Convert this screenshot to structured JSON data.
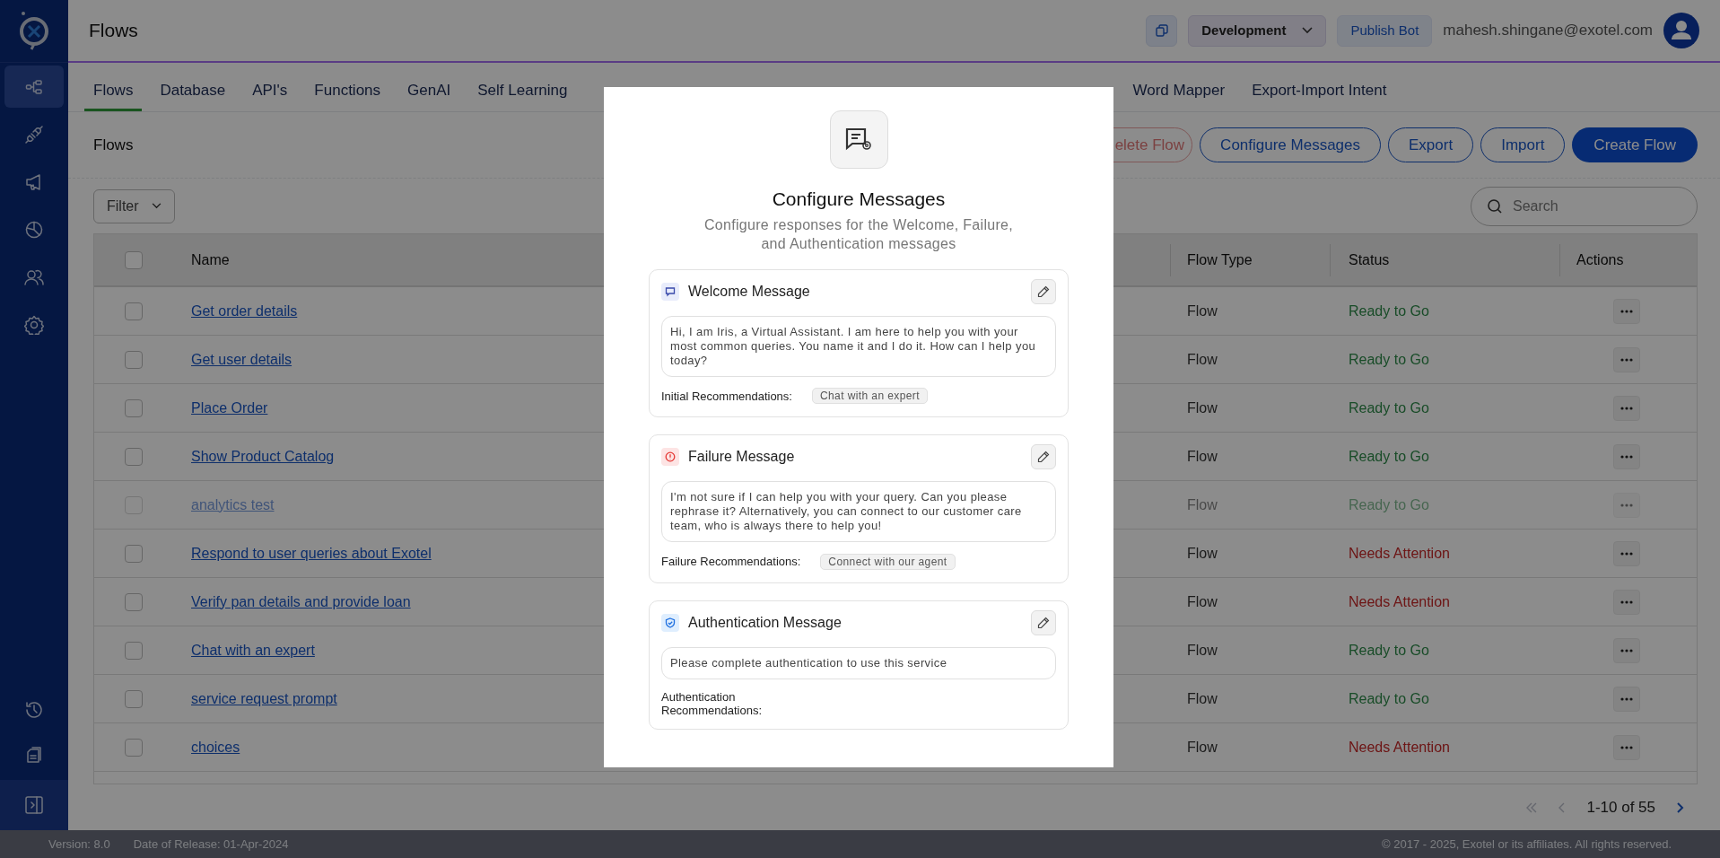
{
  "sidebar": {
    "items": [
      {
        "selected": true
      },
      {
        "selected": false
      },
      {
        "selected": false
      },
      {
        "selected": false
      },
      {
        "selected": false
      },
      {
        "selected": false
      }
    ]
  },
  "header": {
    "title": "Flows",
    "environment": "Development",
    "publish_button": "Publish Bot",
    "user_email": "mahesh.shingane@exotel.com"
  },
  "tabs": [
    {
      "label": "Flows",
      "selected": true
    },
    {
      "label": "Database",
      "selected": false
    },
    {
      "label": "API's",
      "selected": false
    },
    {
      "label": "Functions",
      "selected": false
    },
    {
      "label": "GenAI",
      "selected": false
    },
    {
      "label": "Self Learning",
      "selected": false
    },
    {
      "label": "Word Mapper",
      "selected": false
    },
    {
      "label": "Export-Import Intent",
      "selected": false
    }
  ],
  "page": {
    "title": "Flows",
    "buttons": [
      {
        "label": "elete Flow",
        "kind": "danger"
      },
      {
        "label": "Configure Messages",
        "kind": "outline"
      },
      {
        "label": "Export",
        "kind": "outline"
      },
      {
        "label": "Import",
        "kind": "outline"
      },
      {
        "label": "Create Flow",
        "kind": "primary"
      }
    ],
    "filter": "Filter",
    "search": {
      "placeholder": "Search"
    }
  },
  "table": {
    "select_all_checked": false,
    "columns": [
      "Name",
      "Flow Type",
      "Status",
      "Actions"
    ],
    "rows": [
      {
        "name": "Get order details",
        "flow_type": "Flow",
        "status": "Ready to Go",
        "needs_attention": false,
        "checked": false,
        "disabled": false
      },
      {
        "name": "Get user details",
        "flow_type": "Flow",
        "status": "Ready to Go",
        "needs_attention": false,
        "checked": false,
        "disabled": false
      },
      {
        "name": "Place Order",
        "flow_type": "Flow",
        "status": "Ready to Go",
        "needs_attention": false,
        "checked": false,
        "disabled": false
      },
      {
        "name": "Show Product Catalog",
        "flow_type": "Flow",
        "status": "Ready to Go",
        "needs_attention": false,
        "checked": false,
        "disabled": false
      },
      {
        "name": "analytics test",
        "flow_type": "Flow",
        "status": "Ready to Go",
        "needs_attention": false,
        "checked": false,
        "disabled": true
      },
      {
        "name": "Respond to user queries about Exotel",
        "flow_type": "Flow",
        "status": "Needs Attention",
        "needs_attention": true,
        "checked": false,
        "disabled": false
      },
      {
        "name": "Verify pan details and provide loan",
        "flow_type": "Flow",
        "status": "Needs Attention",
        "needs_attention": true,
        "checked": false,
        "disabled": false
      },
      {
        "name": "Chat with an expert",
        "flow_type": "Flow",
        "status": "Ready to Go",
        "needs_attention": false,
        "checked": false,
        "disabled": false
      },
      {
        "name": "service request prompt",
        "flow_type": "Flow",
        "status": "Ready to Go",
        "needs_attention": false,
        "checked": false,
        "disabled": false
      },
      {
        "name": "choices",
        "flow_type": "Flow",
        "status": "Needs Attention",
        "needs_attention": true,
        "checked": false,
        "disabled": false
      }
    ]
  },
  "pagination": {
    "range": "1-10 of 55"
  },
  "footer": {
    "version": "Version: 8.0",
    "release": "Date of Release: 01-Apr-2024",
    "copyright": "© 2017 - 2025, Exotel or its affiliates. All rights reserved."
  },
  "modal": {
    "title": "Configure Messages",
    "subtitle": "Configure responses for the Welcome, Failure, and Authentication messages",
    "sections": [
      {
        "kind": "welcome",
        "title": "Welcome Message",
        "message": "Hi, I am Iris, a Virtual Assistant. I am here to help you with your most common queries. You name it and I do it. How can I help you today?",
        "recommendations_label": "Initial Recommendations:",
        "recommendations": [
          "Chat with an expert"
        ]
      },
      {
        "kind": "failure",
        "title": "Failure Message",
        "message": "I'm not sure if I can help you with your query. Can you please rephrase it? Alternatively, you can connect to our customer care team, who is always there to help you!",
        "recommendations_label": "Failure Recommendations:",
        "recommendations": [
          "Connect with our agent"
        ]
      },
      {
        "kind": "auth",
        "title": "Authentication Message",
        "message": "Please complete authentication to use this service",
        "recommendations_label": "Authentication Recommendations:"
      }
    ]
  }
}
